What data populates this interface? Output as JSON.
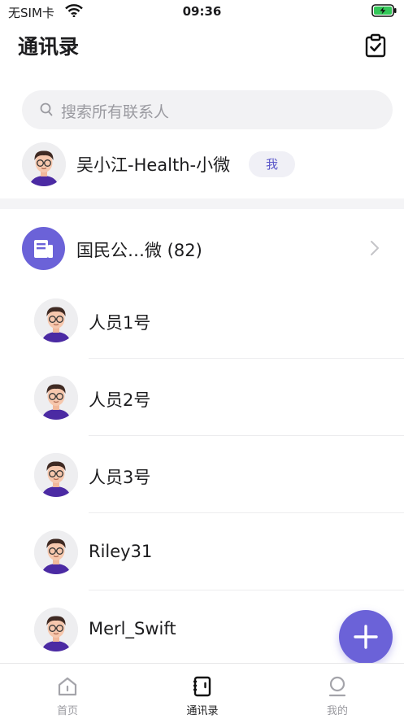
{
  "status_bar": {
    "carrier": "无SIM卡",
    "time": "09:36"
  },
  "header": {
    "title": "通讯录",
    "action_icon": "clipboard-check-icon"
  },
  "search": {
    "placeholder": "搜索所有联系人"
  },
  "me": {
    "name": "吴小江-Health-小微",
    "badge": "我"
  },
  "org": {
    "name": "国民公…微 (82)"
  },
  "contacts": [
    {
      "name": "人员1号"
    },
    {
      "name": "人员2号"
    },
    {
      "name": "人员3号"
    },
    {
      "name": "Riley31"
    },
    {
      "name": "Merl_Swift"
    }
  ],
  "tabs": [
    {
      "label": "首页",
      "icon": "home-icon",
      "active": false
    },
    {
      "label": "通讯录",
      "icon": "contacts-book-icon",
      "active": true
    },
    {
      "label": "我的",
      "icon": "profile-icon",
      "active": false
    }
  ],
  "colors": {
    "accent": "#6b62d8",
    "badge_bg": "#f0f0f6",
    "search_bg": "#f2f2f4"
  }
}
